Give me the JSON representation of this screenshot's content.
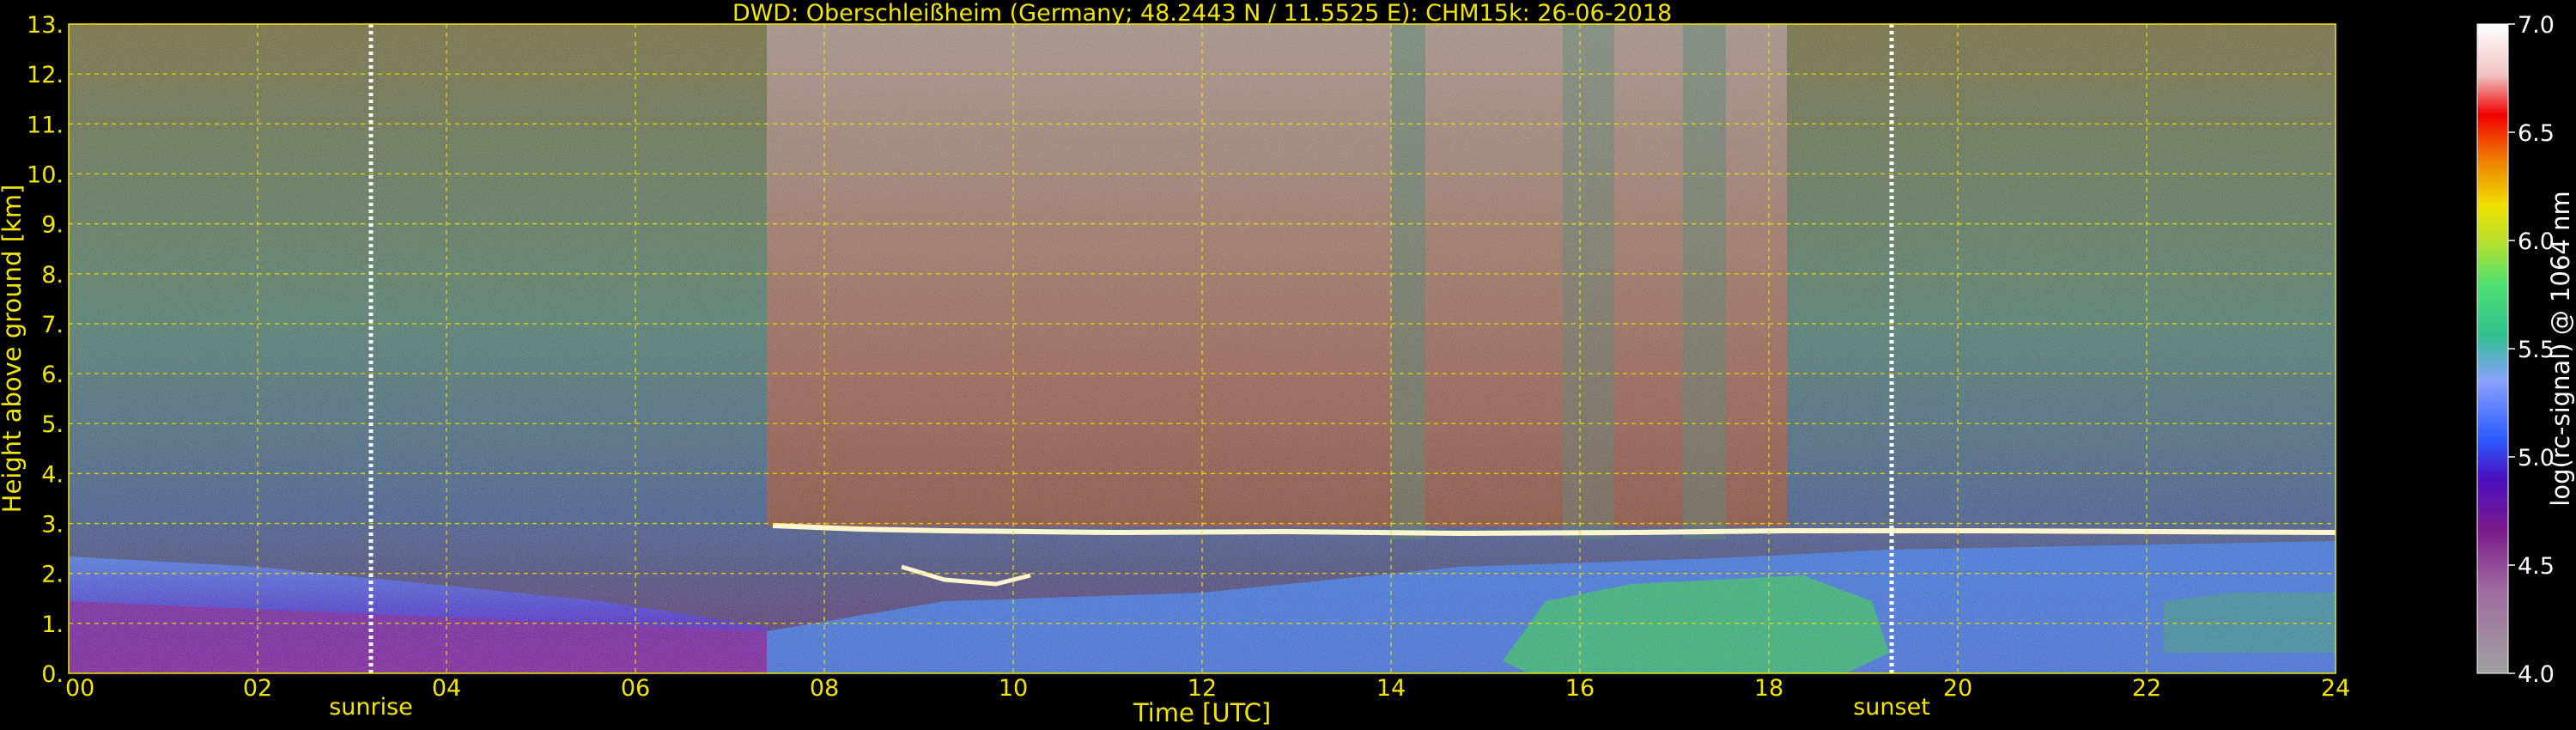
{
  "chart_data": {
    "type": "heatmap",
    "title": "DWD: Oberschleißheim (Germany; 48.2443 N / 11.5525 E):    CHM15k: 26-06-2018",
    "xlabel": "Time [UTC]",
    "ylabel": "Height above ground [km]",
    "xlim": [
      0,
      24
    ],
    "ylim": [
      0,
      13
    ],
    "xticks": [
      "00",
      "02",
      "04",
      "06",
      "08",
      "10",
      "12",
      "14",
      "16",
      "18",
      "20",
      "22",
      "24"
    ],
    "yticks": [
      "0.",
      "1.",
      "2.",
      "3.",
      "4.",
      "5.",
      "6.",
      "7.",
      "8.",
      "9.",
      "10.",
      "11.",
      "12.",
      "13."
    ],
    "grid": true,
    "markers": [
      {
        "label": "sunrise",
        "x": 3.2
      },
      {
        "label": "sunset",
        "x": 19.3
      }
    ],
    "colorbar": {
      "label": "log(rc-signal) @ 1064 nm",
      "range": [
        4.0,
        7.0
      ],
      "ticks": [
        "4.0",
        "4.5",
        "5.0",
        "5.5",
        "6.0",
        "6.5",
        "7.0"
      ]
    },
    "features": {
      "cloud_top_layer_km": 2.9,
      "boundary_layer_top_km": [
        2.0,
        2.3
      ],
      "daytime_noise_hours": [
        7.4,
        18.2
      ]
    },
    "colors": {
      "axis_text": "#f2e600",
      "background": "#000000",
      "grid": "#f2e600"
    }
  }
}
